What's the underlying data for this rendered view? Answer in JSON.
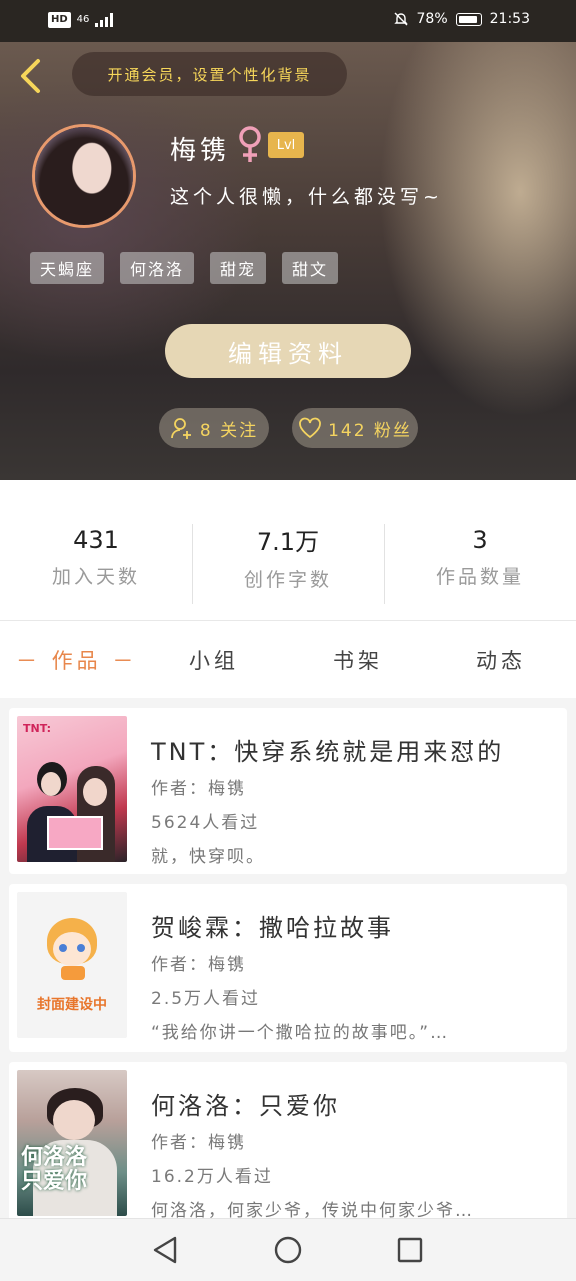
{
  "status_bar": {
    "hd": "HD",
    "network": "46",
    "battery": "78%",
    "time": "21:53"
  },
  "header": {
    "vip_banner": "开通会员，设置个性化背景",
    "username": "梅镌",
    "level": "Lvl",
    "bio": "这个人很懒，什么都没写~",
    "tags": [
      "天蝎座",
      "何洛洛",
      "甜宠",
      "甜文"
    ],
    "edit_button": "编辑资料",
    "following": "8 关注",
    "fans": "142 粉丝"
  },
  "stats": [
    {
      "value": "431",
      "label": "加入天数"
    },
    {
      "value": "7.1万",
      "label": "创作字数"
    },
    {
      "value": "3",
      "label": "作品数量"
    }
  ],
  "tabs": [
    "－ 作品 －",
    "小组",
    "书架",
    "动态"
  ],
  "books": [
    {
      "title": "TNT：快穿系统就是用来怼的",
      "author": "作者：梅镌",
      "views": "5624人看过",
      "desc": "就，快穿呗。",
      "cover_text": "TNT:"
    },
    {
      "title": "贺峻霖：撒哈拉故事",
      "author": "作者：梅镌",
      "views": "2.5万人看过",
      "desc": "“我给你讲一个撒哈拉的故事吧。”…",
      "cover_text": "封面建设中"
    },
    {
      "title": "何洛洛：只爱你",
      "author": "作者：梅镌",
      "views": "16.2万人看过",
      "desc": "何洛洛，何家少爷，传说中何家少爷…",
      "cover_text": "何洛洛只爱你"
    }
  ],
  "colors": {
    "accent": "#e8874c",
    "gold": "#f4d460",
    "edit_button": "#e6d7b5"
  }
}
